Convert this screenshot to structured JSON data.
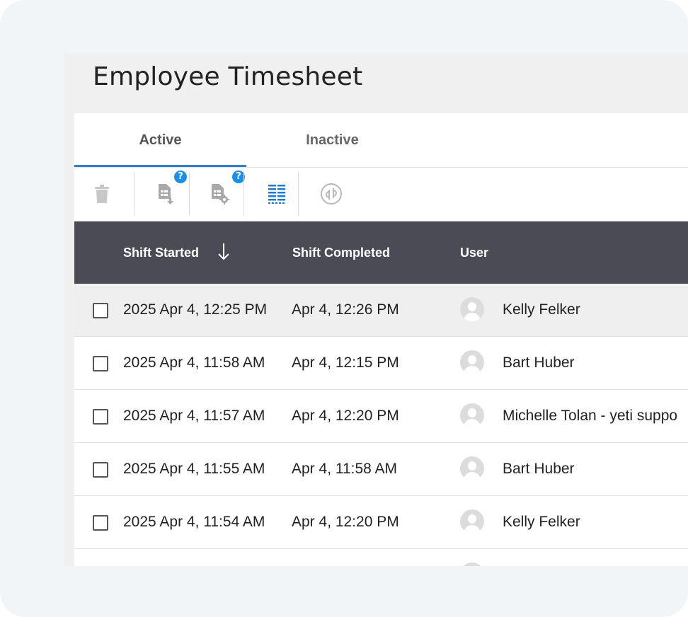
{
  "page": {
    "title": "Employee Timesheet"
  },
  "tabs": [
    {
      "label": "Active",
      "active": true
    },
    {
      "label": "Inactive",
      "active": false
    }
  ],
  "toolbar": {
    "tools": [
      {
        "icon": "trash-icon"
      },
      {
        "icon": "export-document-icon",
        "help": "?"
      },
      {
        "icon": "document-settings-icon",
        "help": "?"
      },
      {
        "icon": "column-list-icon"
      },
      {
        "icon": "quickbooks-icon"
      }
    ]
  },
  "table": {
    "columns": [
      "Shift Started",
      "Shift Completed",
      "User"
    ],
    "sort_icon": "arrow-down-icon",
    "rows": [
      {
        "started": "2025 Apr 4, 12:25 PM",
        "completed": "Apr 4, 12:26 PM",
        "user": "Kelly Felker"
      },
      {
        "started": "2025 Apr 4, 11:58 AM",
        "completed": "Apr 4, 12:15 PM",
        "user": "Bart Huber"
      },
      {
        "started": "2025 Apr 4, 11:57 AM",
        "completed": "Apr 4, 12:20 PM",
        "user": "Michelle Tolan - yeti suppo"
      },
      {
        "started": "2025 Apr 4, 11:55 AM",
        "completed": "Apr 4, 11:58 AM",
        "user": "Bart Huber"
      },
      {
        "started": "2025 Apr 4, 11:54 AM",
        "completed": "Apr 4, 12:20 PM",
        "user": "Kelly Felker"
      }
    ]
  },
  "colors": {
    "accent": "#2f7fd1",
    "header_bg": "#4a4b55",
    "help_badge": "#1a8fe8"
  }
}
